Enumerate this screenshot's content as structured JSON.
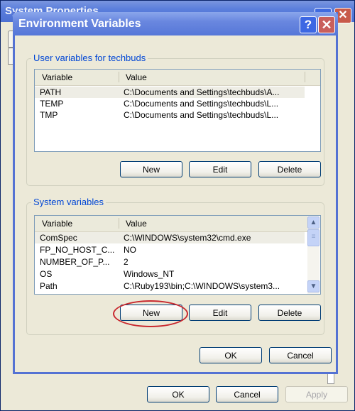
{
  "outer_window": {
    "title": "System Properties",
    "buttons": {
      "ok": "OK",
      "cancel": "Cancel",
      "apply": "Apply"
    },
    "help_icon": "?",
    "close_icon": "✕"
  },
  "dialog": {
    "title": "Environment Variables",
    "help_icon": "?",
    "close_icon": "✕",
    "user_variables": {
      "label": "User variables for techbuds",
      "columns": [
        "Variable",
        "Value"
      ],
      "rows": [
        {
          "variable": "PATH",
          "value": "C:\\Documents and Settings\\techbuds\\A..."
        },
        {
          "variable": "TEMP",
          "value": "C:\\Documents and Settings\\techbuds\\L..."
        },
        {
          "variable": "TMP",
          "value": "C:\\Documents and Settings\\techbuds\\L..."
        }
      ],
      "buttons": {
        "new": "New",
        "edit": "Edit",
        "delete": "Delete"
      }
    },
    "system_variables": {
      "label": "System variables",
      "columns": [
        "Variable",
        "Value"
      ],
      "rows": [
        {
          "variable": "ComSpec",
          "value": "C:\\WINDOWS\\system32\\cmd.exe"
        },
        {
          "variable": "FP_NO_HOST_C...",
          "value": "NO"
        },
        {
          "variable": "NUMBER_OF_P...",
          "value": "2"
        },
        {
          "variable": "OS",
          "value": "Windows_NT"
        },
        {
          "variable": "Path",
          "value": "C:\\Ruby193\\bin;C:\\WINDOWS\\system3..."
        }
      ],
      "buttons": {
        "new": "New",
        "edit": "Edit",
        "delete": "Delete"
      },
      "scroll_up_icon": "▲",
      "scroll_down_icon": "▼",
      "thumb_grip_icon": "≡"
    },
    "buttons": {
      "ok": "OK",
      "cancel": "Cancel"
    }
  },
  "annotation": {
    "highlight_target": "System variables New button",
    "color": "#c8282e"
  }
}
